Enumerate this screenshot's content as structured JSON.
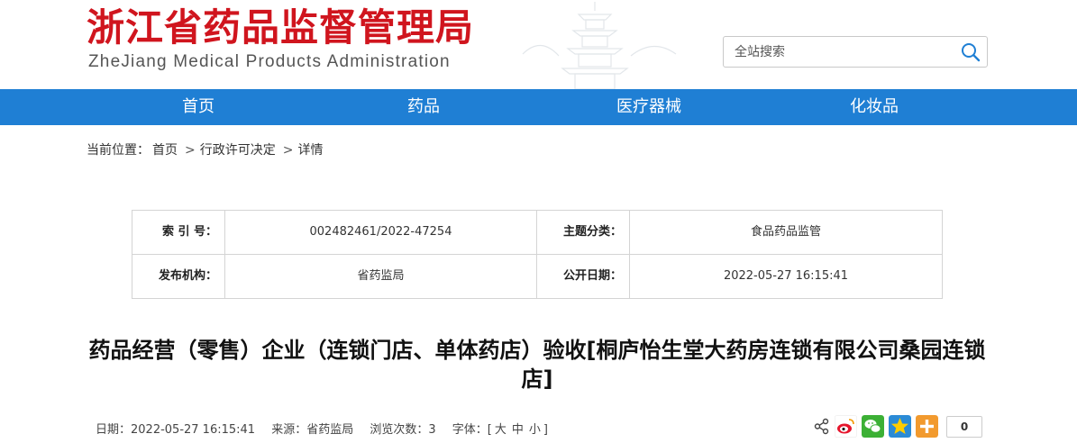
{
  "header": {
    "logo_cn": "浙江省药品监督管理局",
    "logo_en": "ZheJiang Medical Products Administration",
    "search_placeholder": "全站搜索"
  },
  "nav": {
    "items": [
      "首页",
      "药品",
      "医疗器械",
      "化妆品"
    ]
  },
  "breadcrumb": {
    "prefix": "当前位置：",
    "items": [
      "首页",
      "行政许可决定",
      "详情"
    ],
    "separator": ">"
  },
  "meta": {
    "index_label": "索 引 号：",
    "index_value": "002482461/2022-47254",
    "category_label": "主题分类：",
    "category_value": "食品药品监管",
    "publisher_label": "发布机构：",
    "publisher_value": "省药监局",
    "date_label": "公开日期：",
    "date_value": "2022-05-27 16:15:41"
  },
  "article": {
    "title": "药品经营（零售）企业（连锁门店、单体药店）验收[桐庐怡生堂大药房连锁有限公司桑园连锁店]",
    "date": "日期：2022-05-27 16:15:41",
    "source": "来源：省药监局",
    "views": "浏览次数：3",
    "font_label": "字体：[",
    "font_sizes": [
      "大",
      "中",
      "小"
    ],
    "font_close": "]"
  },
  "share": {
    "count": "0",
    "icons": [
      "share-icon",
      "weibo-icon",
      "wechat-icon",
      "qzone-icon",
      "more-icon"
    ]
  },
  "colors": {
    "brand_red": "#d0151e",
    "nav_blue": "#1f7fd4"
  }
}
